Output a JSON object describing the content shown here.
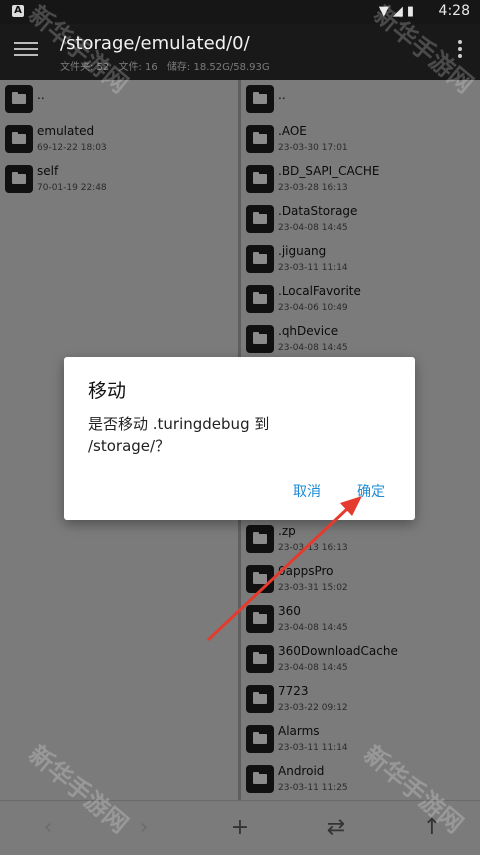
{
  "status_bar": {
    "notification": "A",
    "time": "4:28",
    "icons": [
      "wifi-icon",
      "signal-icon",
      "battery-icon"
    ]
  },
  "app_bar": {
    "path": "/storage/emulated/0/",
    "stats": {
      "folders": "文件夹: 52",
      "files": "文件: 16",
      "storage": "储存: 18.52G/58.93G"
    }
  },
  "left_pane": {
    "items": [
      {
        "name": "..",
        "date": ""
      },
      {
        "name": "emulated",
        "date": "69-12-22 18:03"
      },
      {
        "name": "self",
        "date": "70-01-19 22:48"
      }
    ]
  },
  "right_pane": {
    "items": [
      {
        "name": "..",
        "date": ""
      },
      {
        "name": ".AOE",
        "date": "23-03-30 17:01"
      },
      {
        "name": ".BD_SAPI_CACHE",
        "date": "23-03-28 16:13"
      },
      {
        "name": ".DataStorage",
        "date": "23-04-08 14:45"
      },
      {
        "name": ".jiguang",
        "date": "23-03-11 11:14"
      },
      {
        "name": ".LocalFavorite",
        "date": "23-04-06 10:49"
      },
      {
        "name": ".qhDevice",
        "date": "23-04-08 14:45"
      },
      {
        "name": ".zp",
        "date": "23-03-13 16:13"
      },
      {
        "name": "0appsPro",
        "date": "23-03-31 15:02"
      },
      {
        "name": "360",
        "date": "23-04-08 14:45"
      },
      {
        "name": "360DownloadCache",
        "date": "23-04-08 14:45"
      },
      {
        "name": "7723",
        "date": "23-03-22 09:12"
      },
      {
        "name": "Alarms",
        "date": "23-03-11 11:14"
      },
      {
        "name": "Android",
        "date": "23-03-11 11:25"
      }
    ]
  },
  "dialog": {
    "title": "移动",
    "message": "是否移动 .turingdebug 到 /storage/？",
    "cancel": "取消",
    "ok": "确定"
  },
  "bottom_bar": {
    "back": "‹",
    "forward": "›",
    "add": "+",
    "swap": "⇄",
    "up": "↑"
  },
  "watermark": "新华手游网",
  "colors": {
    "accent": "#1c8bd6",
    "arrow": "#e53a2e"
  }
}
